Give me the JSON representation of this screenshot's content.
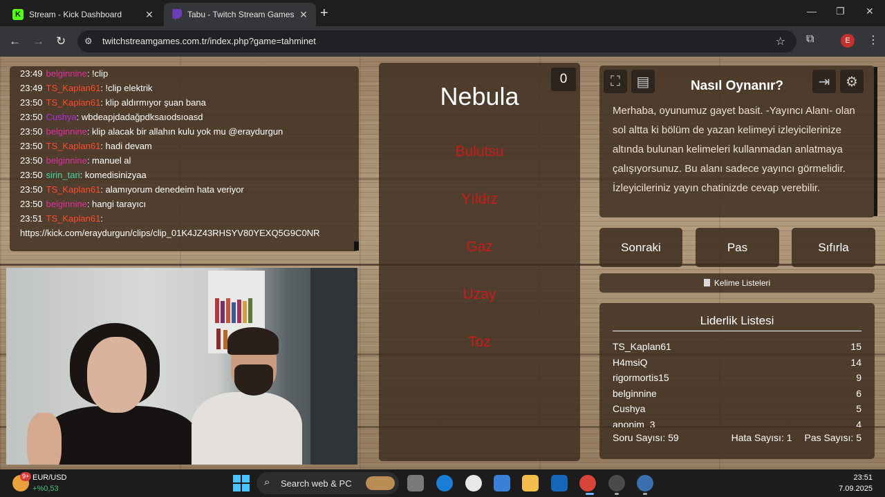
{
  "browser": {
    "tabs": [
      {
        "title": "Stream - Kick Dashboard",
        "icon": "kick-icon"
      },
      {
        "title": "Tabu - Twitch Stream Games",
        "icon": "twitch-icon"
      }
    ],
    "url": "twitchstreamgames.com.tr/index.php?game=tahminet",
    "profile_initial": "E"
  },
  "chat": [
    {
      "time": "23:49",
      "user": "belginnine",
      "color": "#e0319f",
      "msg": ": !clip"
    },
    {
      "time": "23:49",
      "user": "TS_Kaplan61",
      "color": "#ff4a2e",
      "msg": ": !clip elektrik"
    },
    {
      "time": "23:50",
      "user": "TS_Kaplan61",
      "color": "#ff4a2e",
      "msg": ": klip aldırmıyor şuan bana"
    },
    {
      "time": "23:50",
      "user": "Cushya",
      "color": "#b02ce0",
      "msg": ": wbdeapjdadağpdksaıodsıoasd"
    },
    {
      "time": "23:50",
      "user": "belginnine",
      "color": "#e0319f",
      "msg": ": klip alacak bir allahın kulu yok mu @eraydurgun"
    },
    {
      "time": "23:50",
      "user": "TS_Kaplan61",
      "color": "#ff4a2e",
      "msg": ": hadi devam"
    },
    {
      "time": "23:50",
      "user": "belginnine",
      "color": "#e0319f",
      "msg": ": manuel al"
    },
    {
      "time": "23:50",
      "user": "sirin_tari",
      "color": "#3fd6a4",
      "msg": ": komedisinizyaa"
    },
    {
      "time": "23:50",
      "user": "TS_Kaplan61",
      "color": "#ff4a2e",
      "msg": ": alamıyorum denedeim hata veriyor"
    },
    {
      "time": "23:50",
      "user": "belginnine",
      "color": "#e0319f",
      "msg": ": hangi tarayıcı"
    },
    {
      "time": "23:51",
      "user": "TS_Kaplan61",
      "color": "#ff4a2e",
      "msg": ": https://kick.com/eraydurgun/clips/clip_01K4JZ43RHSYV80YEXQ5G9C0NR"
    }
  ],
  "card": {
    "score": "0",
    "word": "Nebula",
    "taboo": [
      "Bulutsu",
      "Yıldız",
      "Gaz",
      "Uzay",
      "Toz"
    ]
  },
  "howto": {
    "title": "Nasıl Oynanır?",
    "text": "Merhaba, oyunumuz gayet basit. -Yayıncı Alanı- olan sol altta ki bölüm de yazan kelimeyi izleyicilerinize altında bulunan kelimeleri kullanmadan anlatmaya çalışıyorsunuz. Bu alanı sadece yayıncı görmelidir. İzleyicileriniz yayın chatinizde cevap verebilir."
  },
  "buttons": {
    "next": "Sonraki",
    "pass": "Pas",
    "reset": "Sıfırla",
    "word_lists": "Kelime Listeleri"
  },
  "leaderboard": {
    "title": "Liderlik Listesi",
    "rows": [
      {
        "name": "TS_Kaplan61",
        "score": "15"
      },
      {
        "name": "H4msiQ",
        "score": "14"
      },
      {
        "name": "rigormortis15",
        "score": "9"
      },
      {
        "name": "belginnine",
        "score": "6"
      },
      {
        "name": "Cushya",
        "score": "5"
      },
      {
        "name": "anonim_3",
        "score": "4"
      }
    ],
    "questions": "Soru Sayısı: 59",
    "errors": "Hata Sayısı: 1",
    "passes": "Pas Sayısı: 5"
  },
  "taskbar": {
    "widget_badge": "9+",
    "widget_title": "EUR/USD",
    "widget_value": "+%0,53",
    "search_label": "Search web & PC",
    "time": "23:51",
    "date": "7.09.2025"
  }
}
